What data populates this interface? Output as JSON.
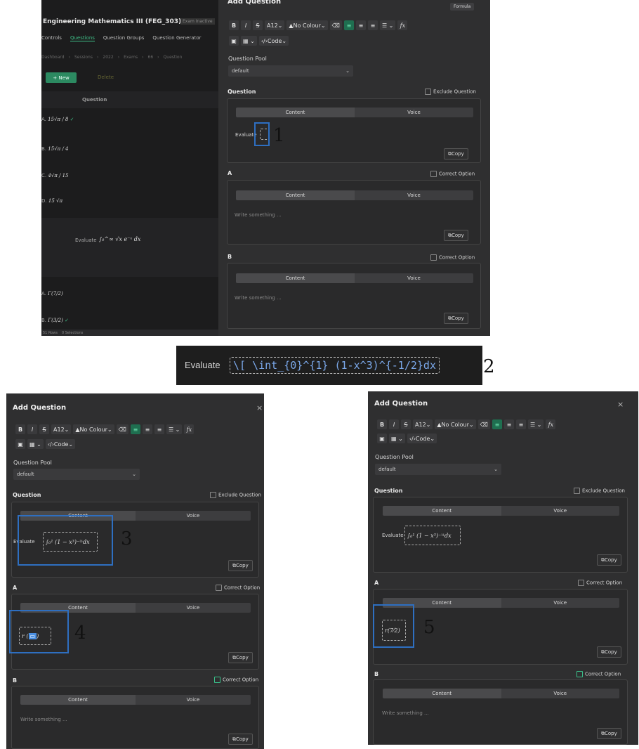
{
  "editor": {
    "title": "Add Question",
    "toolbar": {
      "bold": "B",
      "italic": "I",
      "strike": "S",
      "font_size": "12",
      "colour": "No Colour",
      "code": "Code",
      "formula_tooltip": "Formula",
      "fx": "fx"
    },
    "pool_label": "Question Pool",
    "pool_value": "default",
    "question_label": "Question",
    "exclude_label": "Exclude Question",
    "tab_content": "Content",
    "tab_voice": "Voice",
    "copy_label": "Copy",
    "option_a_label": "A",
    "option_b_label": "B",
    "correct_option_label": "Correct Option",
    "placeholder": "Write something ...",
    "question_text": "Evaluate"
  },
  "background_app": {
    "course_title": "Engineering Mathematics III (FEG_303)",
    "exam_badge": "Exam Inactive",
    "nav": [
      "Controls",
      "Questions",
      "Question Groups",
      "Question Generator"
    ],
    "breadcrumb": [
      "Dashboard",
      "Sessions",
      "2022",
      "Exams",
      "66",
      "Question"
    ],
    "new_button": "+ New",
    "delete_button": "Delete",
    "column_header": "Question",
    "options_prefix": [
      "A.",
      "B.",
      "C.",
      "D."
    ],
    "question_row_prefix": "Evaluate",
    "footer_rows": "51 Rows",
    "footer_sel": "0 Selections"
  },
  "latex_source": "\\[ \\int_{0}^{1} (1-x^3)^{-1/2}dx",
  "callout_numbers": [
    "1",
    "2",
    "3",
    "4",
    "5"
  ]
}
